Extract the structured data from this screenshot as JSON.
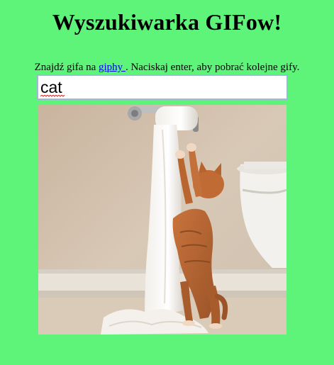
{
  "header": {
    "title": "Wyszukiwarka GIFow!"
  },
  "intro": {
    "text_before": "Znajdź gifa na ",
    "link_label": "giphy ",
    "text_after": ". Naciskaj enter, aby pobrać kolejne gify."
  },
  "search": {
    "value": "cat"
  },
  "colors": {
    "background": "#5ef47a",
    "link": "#0000ee"
  },
  "icons": {
    "gif": "kitten-toilet-paper-image"
  }
}
